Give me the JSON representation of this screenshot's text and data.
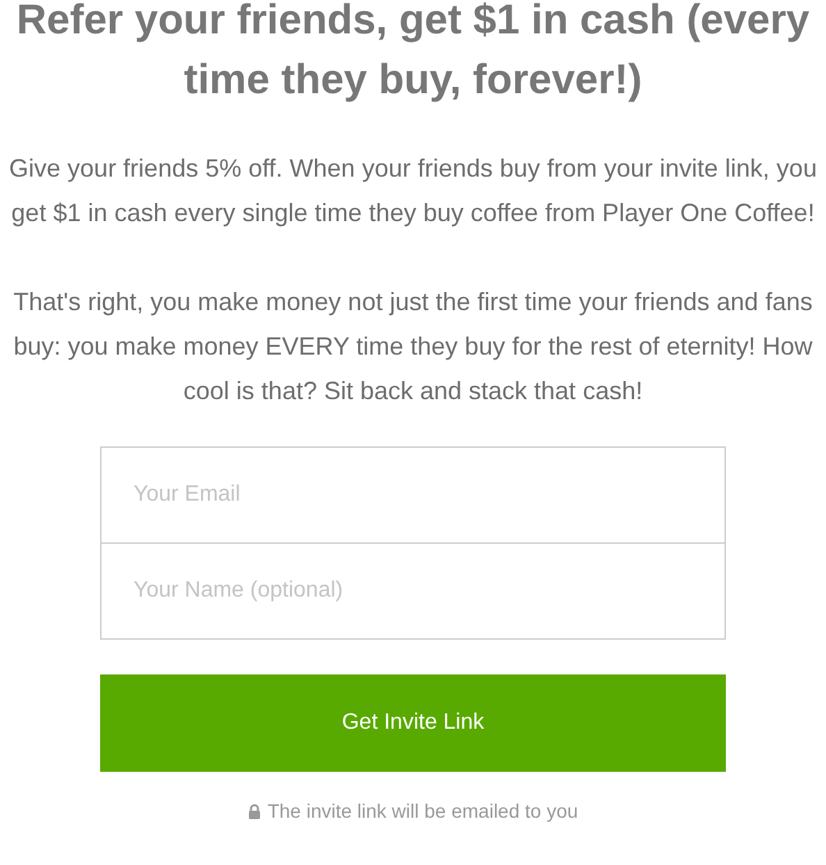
{
  "heading": "Refer your friends, get $1 in cash (every time they buy, forever!)",
  "paragraphs": [
    "Give your friends 5% off. When your friends buy from your invite link, you get $1 in cash every single time they buy coffee from Player One Coffee!",
    "That's right, you make money not just the first time your friends and fans buy: you make money EVERY time they buy for the rest of eternity! How cool is that? Sit back and stack that cash!"
  ],
  "fields": [
    {
      "placeholder": "Your Email"
    },
    {
      "placeholder": "Your Name (optional)"
    }
  ],
  "button": {
    "label": "Get Invite Link"
  },
  "note": "The invite link will be emailed to you"
}
